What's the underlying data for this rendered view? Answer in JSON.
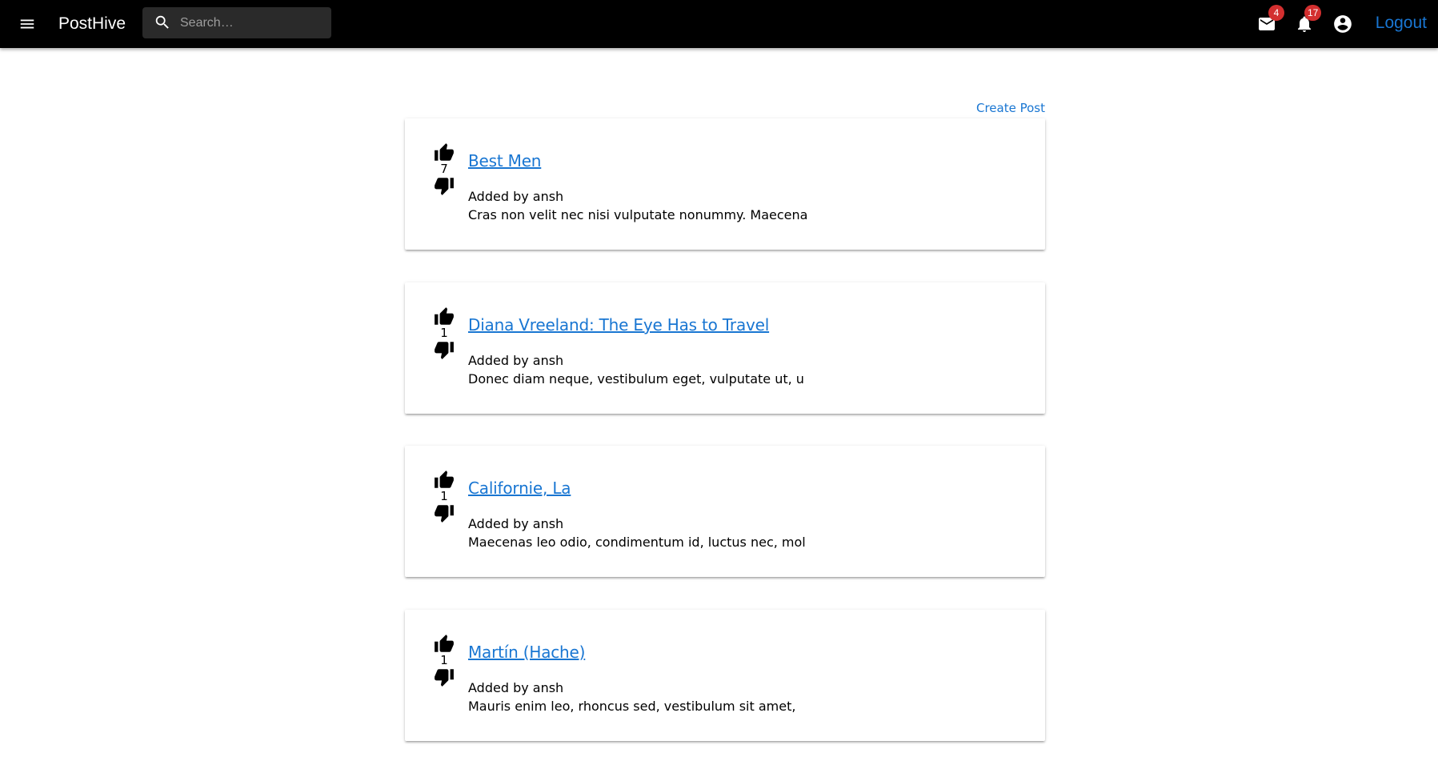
{
  "app": {
    "brand": "PostHive"
  },
  "search": {
    "placeholder": "Search…",
    "value": ""
  },
  "header": {
    "mail_count": "4",
    "notification_count": "17",
    "logout_label": "Logout"
  },
  "icons": {
    "menu": "menu-icon",
    "search": "search-icon",
    "mail": "mail-icon",
    "notifications": "bell-icon",
    "account": "account-circle-icon",
    "upvote": "thumb-up-icon",
    "downvote": "thumb-down-icon"
  },
  "colors": {
    "appbar": "#000000",
    "link": "#1976d2",
    "badge": "#d32f2f"
  },
  "main": {
    "create_post_label": "Create Post"
  },
  "posts": [
    {
      "title": "Best Men",
      "votes": "7",
      "author_line": "Added by ansh",
      "excerpt": "Cras non velit nec nisi vulputate nonummy. Maecena"
    },
    {
      "title": "Diana Vreeland: The Eye Has to Travel",
      "votes": "1",
      "author_line": "Added by ansh",
      "excerpt": "Donec diam neque, vestibulum eget, vulputate ut, u"
    },
    {
      "title": "Californie, La",
      "votes": "1",
      "author_line": "Added by ansh",
      "excerpt": "Maecenas leo odio, condimentum id, luctus nec, mol"
    },
    {
      "title": "Martín (Hache)",
      "votes": "1",
      "author_line": "Added by ansh",
      "excerpt": "Mauris enim leo, rhoncus sed, vestibulum sit amet,"
    }
  ]
}
